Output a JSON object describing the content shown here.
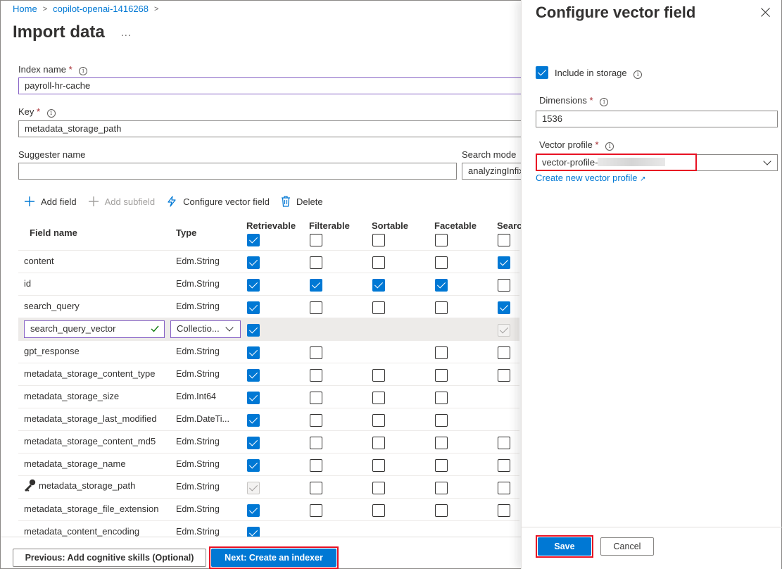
{
  "breadcrumb": {
    "home": "Home",
    "resource": "copilot-openai-1416268"
  },
  "page": {
    "title": "Import data",
    "more": "..."
  },
  "form": {
    "index_name_label": "Index name",
    "index_name_value": "payroll-hr-cache",
    "key_label": "Key",
    "key_value": "metadata_storage_path",
    "suggester_label": "Suggester name",
    "suggester_value": "",
    "search_mode_label": "Search mode",
    "search_mode_value": "analyzingInfix",
    "required_mark": "*",
    "info_glyph": "i"
  },
  "toolbar": {
    "add_field": "Add field",
    "add_subfield": "Add subfield",
    "configure_vector": "Configure vector field",
    "delete": "Delete"
  },
  "table": {
    "headers": {
      "field_name": "Field name",
      "type": "Type",
      "retrievable": "Retrievable",
      "filterable": "Filterable",
      "sortable": "Sortable",
      "facetable": "Facetable",
      "searchable": "Searchable"
    },
    "rows": [
      {
        "name": "content",
        "type": "Edm.String"
      },
      {
        "name": "id",
        "type": "Edm.String"
      },
      {
        "name": "search_query",
        "type": "Edm.String"
      },
      {
        "name": "search_query_vector",
        "type": "Collection(Edm.Single)"
      },
      {
        "name": "gpt_response",
        "type": "Edm.String"
      },
      {
        "name": "metadata_storage_content_type",
        "type": "Edm.String"
      },
      {
        "name": "metadata_storage_size",
        "type": "Edm.Int64"
      },
      {
        "name": "metadata_storage_last_modified",
        "type": "Edm.DateTi..."
      },
      {
        "name": "metadata_storage_content_md5",
        "type": "Edm.String"
      },
      {
        "name": "metadata_storage_name",
        "type": "Edm.String"
      },
      {
        "name": "metadata_storage_path",
        "type": "Edm.String"
      },
      {
        "name": "metadata_storage_file_extension",
        "type": "Edm.String"
      },
      {
        "name": "metadata_content_encoding",
        "type": "Edm.String"
      }
    ],
    "editing_type_display": "Collectio..."
  },
  "footer": {
    "previous": "Previous: Add cognitive skills (Optional)",
    "next": "Next: Create an indexer"
  },
  "pane": {
    "title": "Configure vector field",
    "include_storage": "Include in storage",
    "dimensions_label": "Dimensions",
    "dimensions_value": "1536",
    "vector_profile_label": "Vector profile",
    "vector_profile_value": "vector-profile-",
    "create_link": "Create new vector profile",
    "save": "Save",
    "cancel": "Cancel"
  },
  "colors": {
    "accent": "#0078d4",
    "highlight": "#e81123",
    "edit_border": "#8661c5"
  }
}
